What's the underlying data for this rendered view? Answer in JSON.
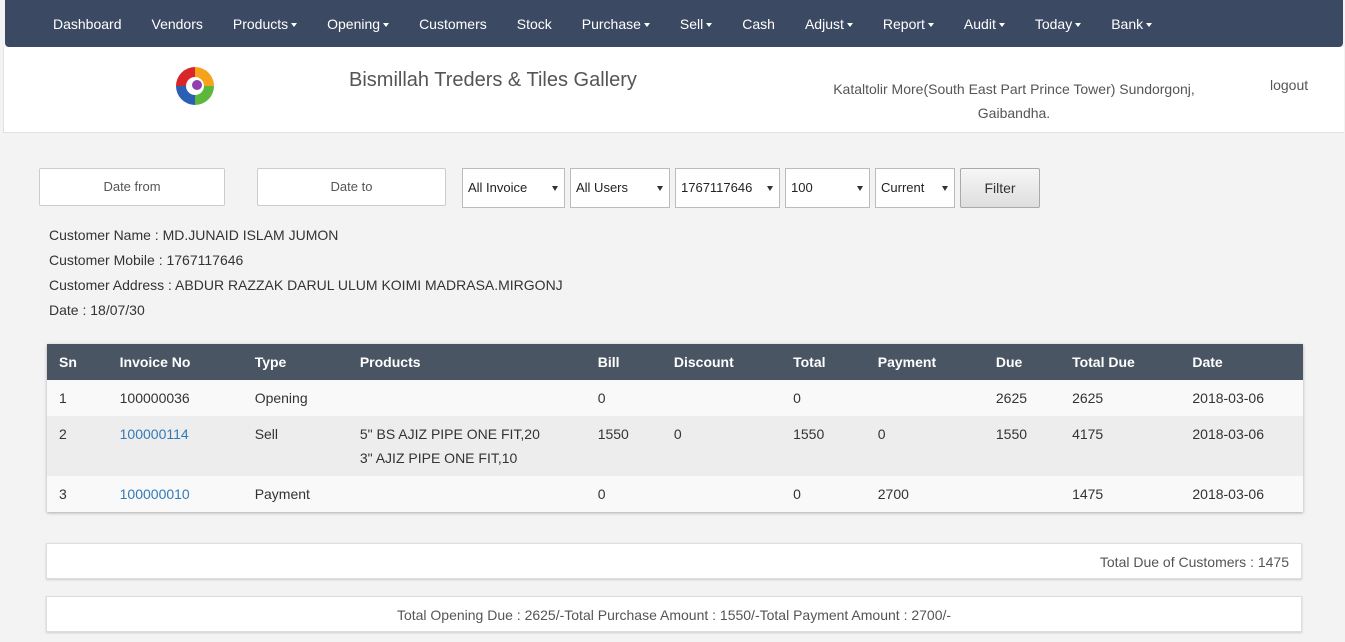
{
  "nav": [
    {
      "label": "Dashboard",
      "dropdown": false
    },
    {
      "label": "Vendors",
      "dropdown": false
    },
    {
      "label": "Products",
      "dropdown": true
    },
    {
      "label": "Opening",
      "dropdown": true
    },
    {
      "label": "Customers",
      "dropdown": false
    },
    {
      "label": "Stock",
      "dropdown": false
    },
    {
      "label": "Purchase",
      "dropdown": true
    },
    {
      "label": "Sell",
      "dropdown": true
    },
    {
      "label": "Cash",
      "dropdown": false
    },
    {
      "label": "Adjust",
      "dropdown": true
    },
    {
      "label": "Report",
      "dropdown": true
    },
    {
      "label": "Audit",
      "dropdown": true
    },
    {
      "label": "Today",
      "dropdown": true
    },
    {
      "label": "Bank",
      "dropdown": true
    }
  ],
  "header": {
    "title": "Bismillah Treders & Tiles Gallery",
    "address_line1": "Kataltolir More(South East Part Prince Tower) Sundorgonj,",
    "address_line2": "Gaibandha.",
    "logout": "logout",
    "logo_icon": "colorful-swirl-logo"
  },
  "filters": {
    "date_from": "Date from",
    "date_to": "Date to",
    "invoice": "All Invoice",
    "users": "All Users",
    "mobile": "1767117646",
    "limit": "100",
    "period": "Current",
    "button": "Filter"
  },
  "customer": {
    "name": "Customer Name : MD.JUNAID ISLAM JUMON",
    "mobile": "Customer Mobile : 1767117646",
    "address": "Customer Address : ABDUR RAZZAK DARUL ULUM KOIMI MADRASA.MIRGONJ",
    "date": "Date : 18/07/30"
  },
  "table": {
    "headers": [
      "Sn",
      "Invoice No",
      "Type",
      "Products",
      "Bill",
      "Discount",
      "Total",
      "Payment",
      "Due",
      "Total Due",
      "Date"
    ],
    "rows": [
      {
        "sn": "1",
        "invoice": "100000036",
        "link": false,
        "type": "Opening",
        "products": [
          "",
          ""
        ],
        "bill": "0",
        "discount": "",
        "total": "0",
        "payment": "",
        "due": "2625",
        "total_due": "2625",
        "date": "2018-03-06"
      },
      {
        "sn": "2",
        "invoice": "100000114",
        "link": true,
        "type": "Sell",
        "products": [
          "5\" BS AJIZ PIPE ONE FIT,20",
          "3\" AJIZ PIPE ONE FIT,10"
        ],
        "bill": "1550",
        "discount": "0",
        "total": "1550",
        "payment": "0",
        "due": "1550",
        "total_due": "4175",
        "date": "2018-03-06"
      },
      {
        "sn": "3",
        "invoice": "100000010",
        "link": true,
        "type": "Payment",
        "products": [
          "",
          ""
        ],
        "bill": "0",
        "discount": "",
        "total": "0",
        "payment": "2700",
        "due": "",
        "total_due": "1475",
        "date": "2018-03-06"
      }
    ]
  },
  "summary": {
    "total_due": "Total Due of Customers : 1475",
    "totals": "Total Opening Due : 2625/-Total Purchase Amount : 1550/-Total Payment Amount : 2700/-"
  },
  "colors": {
    "nav_bg": "#3b4a62",
    "table_head": "#4a5563",
    "link": "#337ab7"
  }
}
